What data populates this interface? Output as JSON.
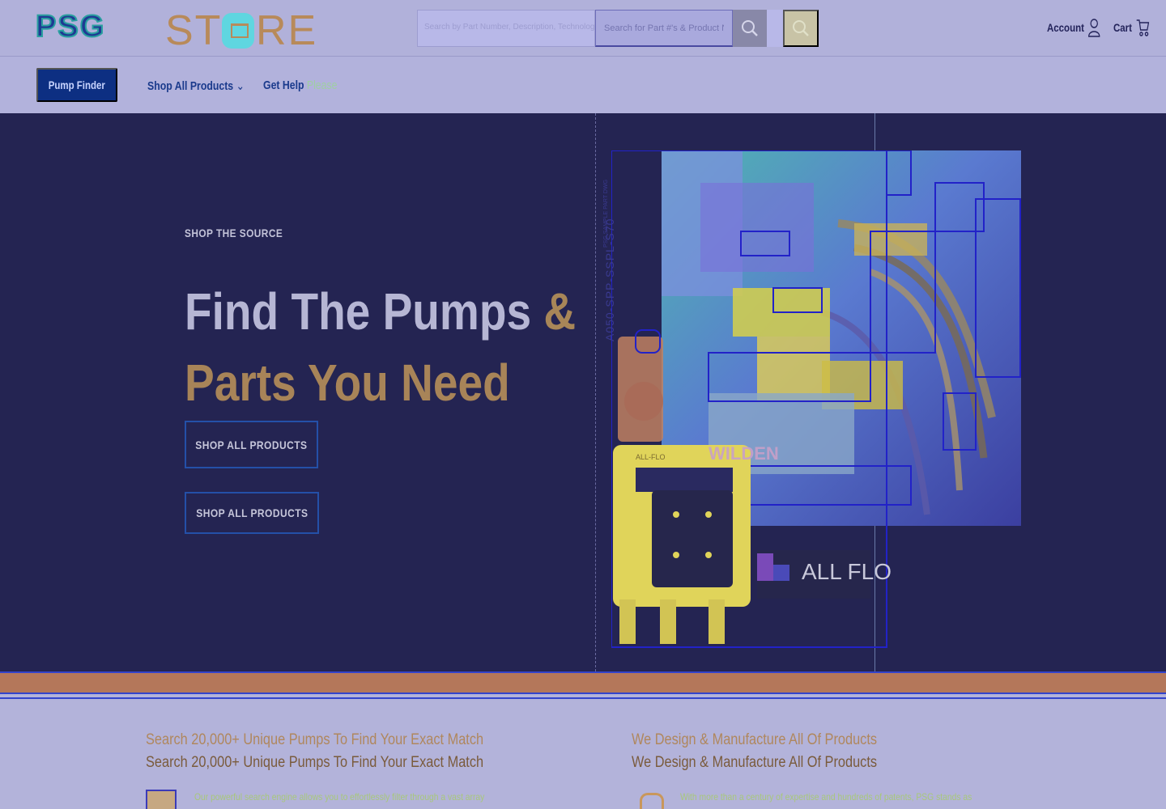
{
  "header": {
    "logo_brand": "PSG",
    "logo_word": "STORE",
    "search_placeholder": "Search for Part #'s & Product Names",
    "search_left_hint": "Search by Part Number, Description, Technology, ...",
    "account_label": "Account",
    "cart_label": "Cart"
  },
  "nav": {
    "pump_finder": "Pump Finder",
    "shop_all": "Shop All Products",
    "get_help": "Get Help",
    "get_help_ghost": "Please"
  },
  "hero": {
    "eyebrow": "SHOP THE SOURCE",
    "title_line1": "Find The Pumps",
    "title_amp": "&",
    "title_line2": "Parts You Need",
    "button_primary": "SHOP ALL PRODUCTS",
    "button_secondary": "SHOP ALL PRODUCTS",
    "image_vertical_text": "A050-SPP-SSPL-S70",
    "image_vertical_small": "PSG SAMPLE PART DWG",
    "brand_wilden": "WILDEN",
    "brand_allflo": "ALL FLO",
    "brand_allflo_small": "ALL-FLO"
  },
  "features": {
    "left_title": "Search 20,000+ Unique Pumps To Find Your Exact Match",
    "left_body": "Our powerful search engine allows you to effortlessly filter through a vast array",
    "right_title": "We Design & Manufacture All Of Products",
    "right_body": "With more than a century of expertise and hundreds of patents, PSG stands as"
  },
  "colors": {
    "hero_bg": "#242452",
    "header_bg": "#b1b1da",
    "accent_blue": "#0d2f82",
    "accent_bronze": "#a88458"
  }
}
